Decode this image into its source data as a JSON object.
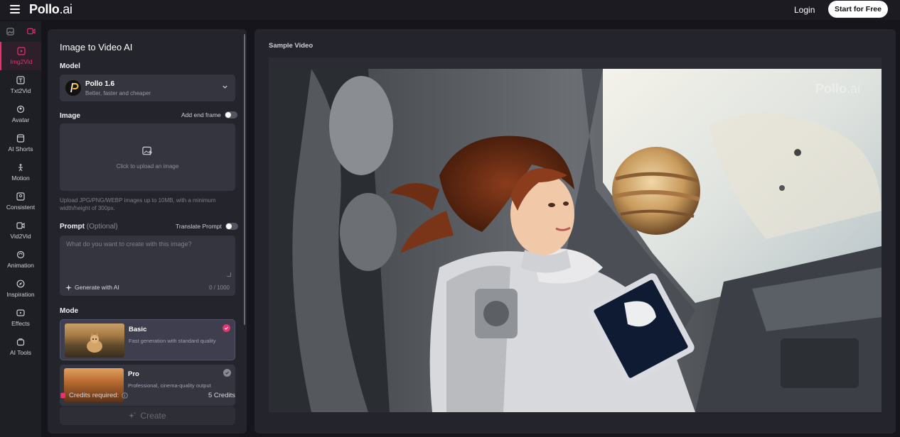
{
  "header": {
    "logo_main": "Pollo",
    "logo_suffix": ".ai",
    "login_label": "Login",
    "start_label": "Start for Free"
  },
  "rail": {
    "items": [
      {
        "label": "Img2Vid",
        "icon": "image-video-icon",
        "active": true
      },
      {
        "label": "Txt2Vid",
        "icon": "text-video-icon"
      },
      {
        "label": "Avatar",
        "icon": "avatar-icon"
      },
      {
        "label": "AI Shorts",
        "icon": "shorts-icon"
      },
      {
        "label": "Motion",
        "icon": "motion-icon"
      },
      {
        "label": "Consistent",
        "icon": "consistent-icon"
      },
      {
        "label": "Vid2Vid",
        "icon": "video-video-icon"
      },
      {
        "label": "Animation",
        "icon": "animation-icon"
      },
      {
        "label": "Inspiration",
        "icon": "compass-icon"
      },
      {
        "label": "Effects",
        "icon": "effects-icon"
      },
      {
        "label": "AI Tools",
        "icon": "tools-icon"
      }
    ]
  },
  "form": {
    "title": "Image to Video AI",
    "model_label": "Model",
    "model_name": "Pollo 1.6",
    "model_desc": "Better, faster and cheaper",
    "image_label": "Image",
    "end_frame_label": "Add end frame",
    "upload_text": "Click to upload an image",
    "upload_hint": "Upload JPG/PNG/WEBP images up to 10MB, with a minimum width/height of 300px.",
    "prompt_label": "Prompt",
    "prompt_optional": "(Optional)",
    "translate_label": "Translate Prompt",
    "prompt_placeholder": "What do you want to create with this image?",
    "generate_label": "Generate with AI",
    "counter": "0 / 1000",
    "mode_label": "Mode",
    "modes": [
      {
        "name": "Basic",
        "desc": "Fast generation with standard quality",
        "selected": true
      },
      {
        "name": "Pro",
        "desc": "Professional, cinema-quality output"
      }
    ],
    "credits_label": "Credits required:",
    "credits_value": "5 Credits",
    "create_label": "Create"
  },
  "sample": {
    "label": "Sample Video",
    "watermark_main": "Pollo",
    "watermark_suffix": ".ai"
  },
  "colors": {
    "accent": "#e8336f",
    "bg": "#15151b",
    "panel": "#24242c",
    "field": "#35353f"
  }
}
